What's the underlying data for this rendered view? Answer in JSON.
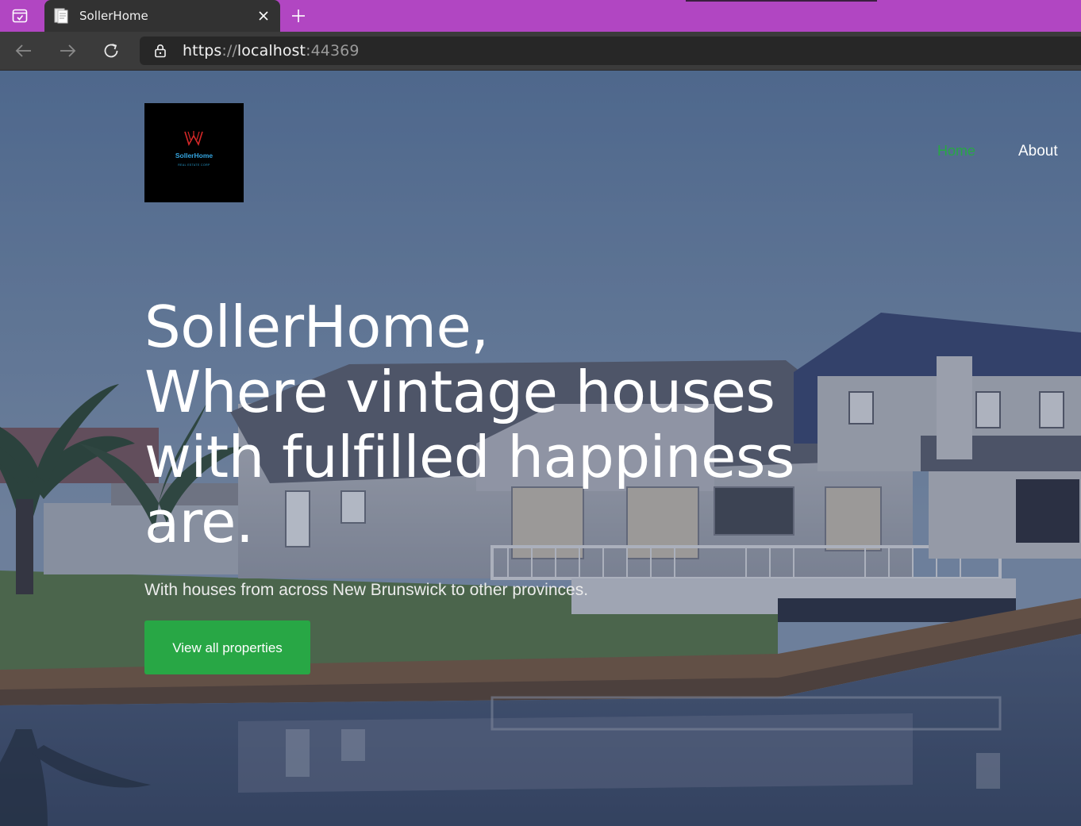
{
  "browser": {
    "tab": {
      "title": "SollerHome"
    },
    "address": {
      "scheme": "https",
      "sep": "://",
      "host": "localhost",
      "port": ":44369"
    }
  },
  "site": {
    "logo": {
      "name": "SollerHome",
      "tagline": "REAL ESTATE CORP"
    },
    "nav": {
      "home": "Home",
      "about": "About"
    },
    "hero": {
      "lines": [
        "SollerHome,",
        "Where vintage houses",
        "with fulfilled happiness",
        "are."
      ],
      "subtitle": "With houses from across New Brunswick to other provinces.",
      "cta": "View all properties"
    }
  },
  "colors": {
    "tabbar": "#b146c2",
    "accent_green": "#28a745",
    "logo_red": "#d62828",
    "logo_blue": "#34a5e0"
  }
}
